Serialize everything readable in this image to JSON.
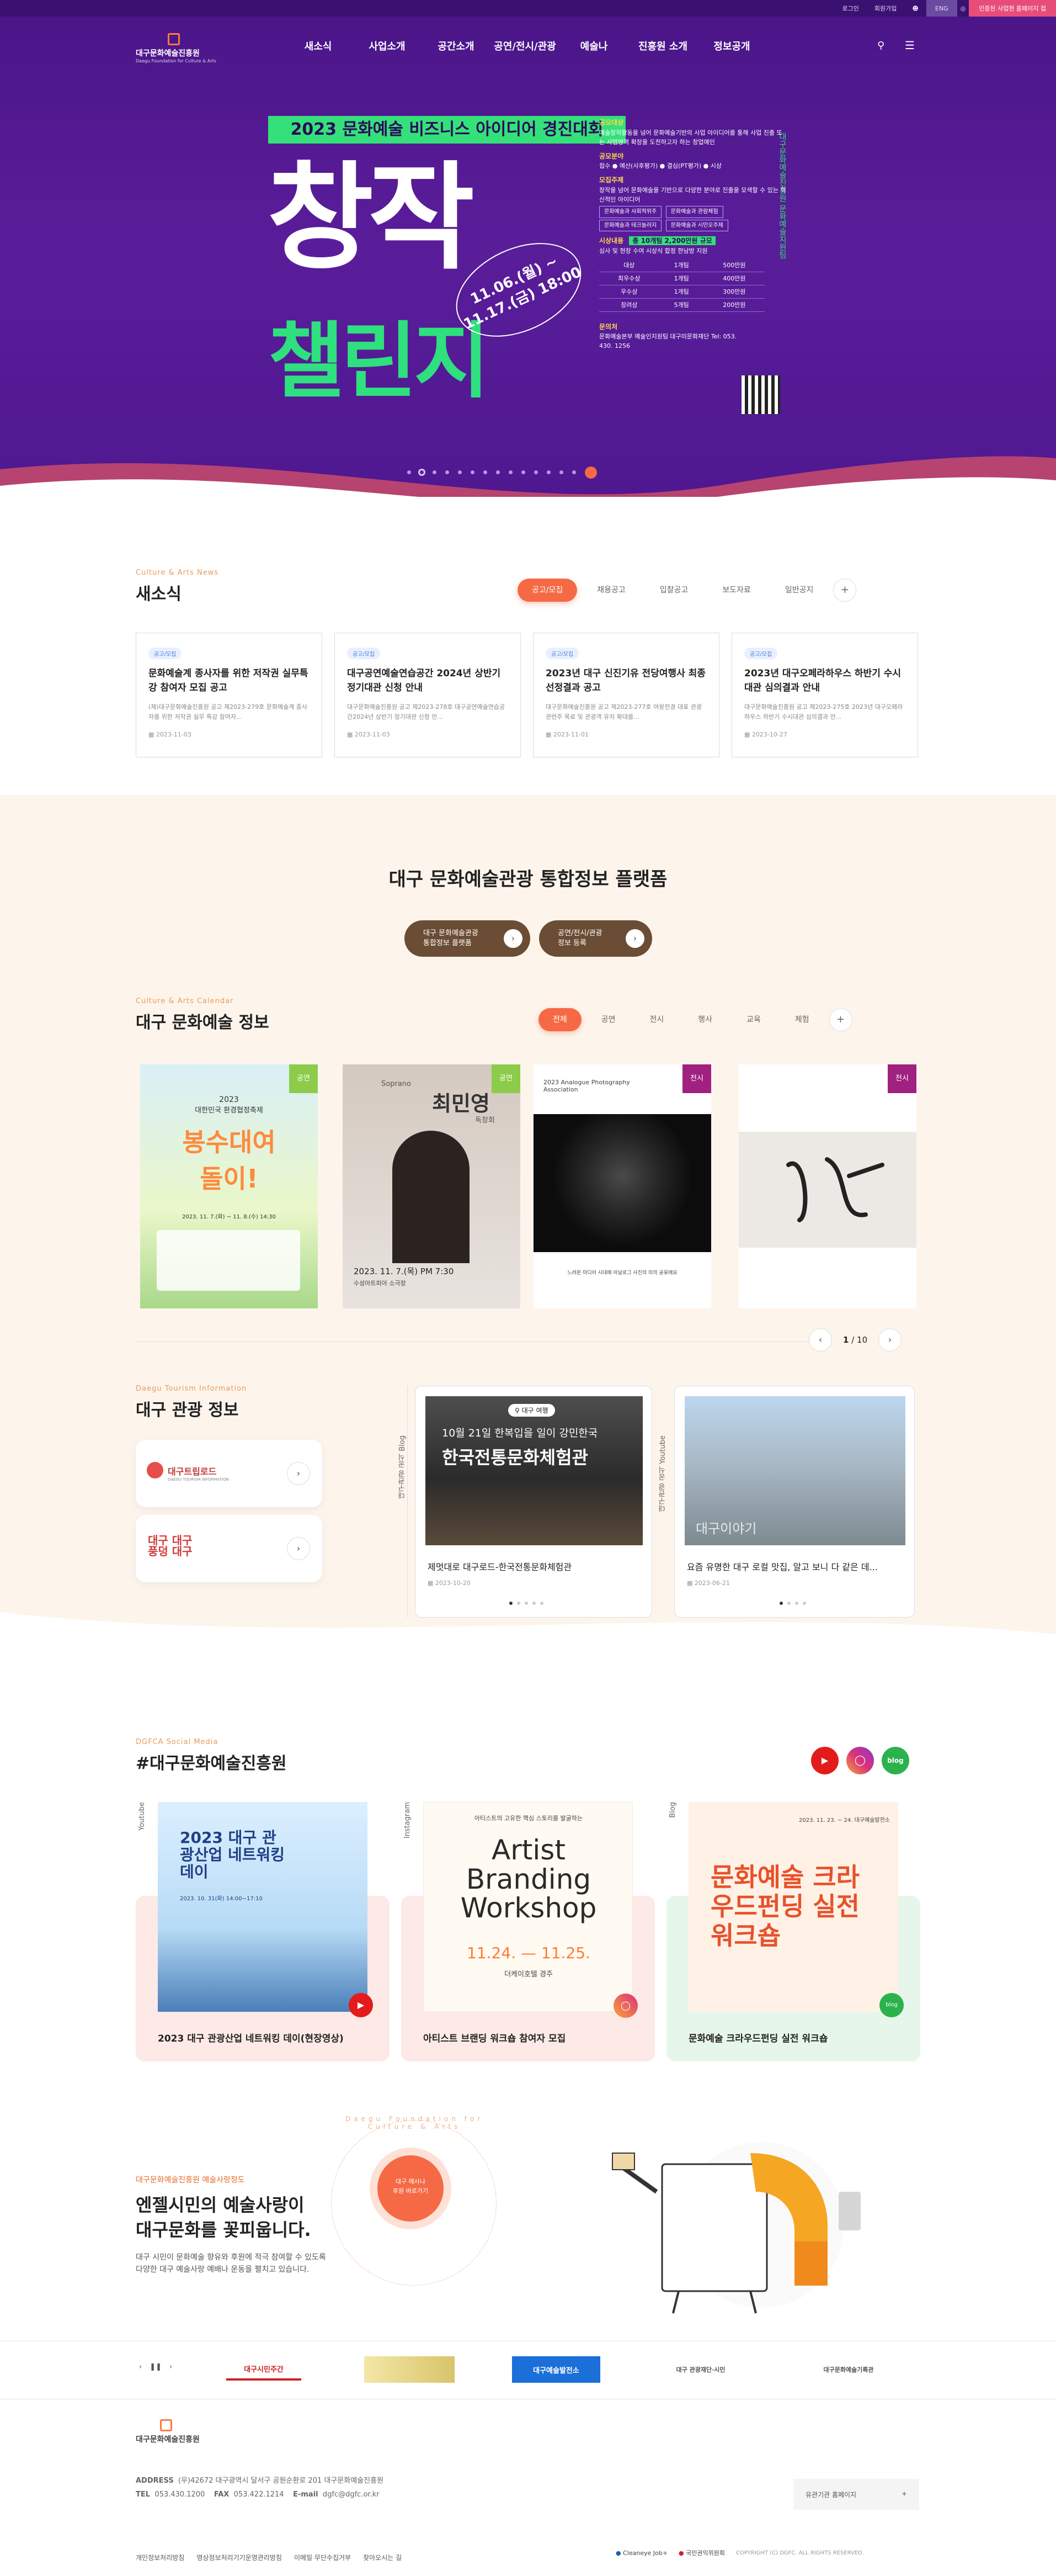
{
  "topbar": {
    "login": "로그인",
    "join": "회원가입",
    "lang": "ENG",
    "ticket": "인증된 사업현 홈페이지 접"
  },
  "header": {
    "logo_name": "대구문화예술진흥원",
    "logo_sub": "Daegu Foundation for Culture & Arts",
    "nav": [
      "새소식",
      "사업소개",
      "공간소개",
      "공연/전시/관광",
      "예술나",
      "진흥원 소개",
      "정보공개"
    ]
  },
  "hero": {
    "contest_title": "2023 문화예술 비즈니스 아이디어 경진대회",
    "big1": "창작",
    "big2": "챌린지",
    "date1": "11.06.(월) ~",
    "date2": "11.17.(금) 18:00",
    "side": "대구문화예술진흥원 문화예술지원팀",
    "info": [
      {
        "h": "공모대상",
        "t": "예술창작활동을 넘어 문화예술기반의 사업 아이디어를 통해 사업 진출 또는 사업영역 확장을 도전하고자 하는 창업예인"
      },
      {
        "h": "공모분야",
        "t": "접수 ● 예산(사후평가) ● 결심(PT평가) ● 시상"
      },
      {
        "h": "모집주제",
        "t": "창작을 넘어 문화예술을 기반으로 다양한 분야로 진출을 모색할 수 있는 혁신적인 아이디어"
      }
    ],
    "chips": [
      "문화예술과 사회적위주",
      "문화예술과 관람체험",
      "문화예술과 테크놀러지",
      "문화예술과 시민오주제"
    ],
    "award_label": "시상내용",
    "award_badge": "총 10개팀 2,200만원 규모",
    "award_note": "심사 및 현장 수여 시상식 합정 한남방 지원",
    "prizes": [
      [
        "대상",
        "1개팀",
        "500만원"
      ],
      [
        "최우수상",
        "1개팀",
        "400만원"
      ],
      [
        "우수상",
        "1개팀",
        "300만원"
      ],
      [
        "장려상",
        "5개팀",
        "200만원"
      ]
    ],
    "inquiry_h": "문의처",
    "inquiry": "문화예술본부 예술인지원팀 대구미문화재단 Tel: 053. 430. 1256"
  },
  "news": {
    "eyebrow": "Culture & Arts News",
    "title": "새소식",
    "tabs": [
      "공고/모집",
      "채용공고",
      "입찰공고",
      "보도자료",
      "일반공지"
    ],
    "plus": "+",
    "items": [
      {
        "badge": "공고/모집",
        "title": "문화예술계 종사자를 위한 저작권 실무특강 참여자 모집 공고",
        "desc": "(재)대구문화예술진흥원 공고 제2023-279호 문화예술계 종사자를 위한 저작권 실무 특강 참여자...",
        "date": "2023-11-03"
      },
      {
        "badge": "공고/모집",
        "title": "대구공연예술연습공간 2024년 상반기 정기대관 신청 안내",
        "desc": "대구문화예술진흥원 공고 제2023-278호 대구공연예술연습공간2024년 상반기 정기대관 신청 안...",
        "date": "2023-11-03"
      },
      {
        "badge": "공고/모집",
        "title": "2023년 대구 신진기유 전당여행사 최종 선정결과 공고",
        "desc": "대구문화예술진흥원 공고 제2023-277호 여왕전경 대표 관광 관련주 목료 및 관광객 유치 확대를...",
        "date": "2023-11-01"
      },
      {
        "badge": "공고/모집",
        "title": "2023년 대구오페라하우스 하반기 수시대관 심의결과 안내",
        "desc": "대구문화예술진흥원 공고 제2023-275호 2023년 대구오페라하우스 하반기 수시대관 심의결과 안...",
        "date": "2023-10-27"
      }
    ]
  },
  "platform": {
    "title": "대구 문화예술관광 통합정보 플랫폼",
    "btn1": [
      "대구 문화예술관광",
      "통합정보 플랫폼"
    ],
    "btn2": [
      "공연/전시/관광",
      "정보 등록"
    ]
  },
  "calendar": {
    "eyebrow": "Culture & Arts Calendar",
    "title": "대구 문화예술 정보",
    "tabs": [
      "전체",
      "공연",
      "전시",
      "행사",
      "교육",
      "체험"
    ],
    "posters": [
      {
        "badge": "공연",
        "year": "2023",
        "line1": "대한민국 환경협정축제",
        "line2": "봉수대여",
        "line3": "돌이!",
        "date": "2023. 11. 7.(화) ~ 11. 8.(수) 14:30",
        "color": "#8ccc4a"
      },
      {
        "badge": "공연",
        "name": "최민영",
        "role": "Soprano",
        "sub": "독창회",
        "date": "2023. 11. 7.(목) PM 7:30",
        "venue": "수성아트피아 소극장",
        "color": "#8ccc4a"
      },
      {
        "badge": "전시",
        "heading": "2023 Analogue Photography Association",
        "caption": "느려운 미디어 시대에 아날로그 사진의 미의 공유에요",
        "color": "#a0217f"
      },
      {
        "badge": "전시",
        "color": "#a0217f"
      }
    ],
    "page_current": "1",
    "page_total": "10"
  },
  "tourism": {
    "eyebrow": "Daegu Tourism Information",
    "title": "대구 관광 정보",
    "card1": "대구트립로드",
    "card1_sub": "DAEGU TOURISM INFORMATION",
    "card2": "대구 대구 풍덩 대구",
    "blog_label": "대구관광 공식 Blog",
    "youtube_label": "대구관광 공식 Youtube",
    "blog": {
      "tag": "대구 여행",
      "head": "10월 21일 한복입을 일이 강민한국",
      "big": "한국전통문화체험관",
      "title": "제멋대로 대구로드-한국전통문화체험관",
      "date": "2023-10-20"
    },
    "youtube": {
      "watermark": "대구이야기",
      "title": "요즘 유명한 대구 로컬 맛집, 알고 보니 다 같은 데...",
      "date": "2023-06-21"
    }
  },
  "social": {
    "eyebrow": "DGFCA Social Media",
    "title": "#대구문화예술진흥원",
    "icons": [
      "Youtube",
      "Instagram",
      "blog"
    ],
    "items": [
      {
        "label": "Youtube",
        "img_title": "2023 대구 관광산업 네트워킹 데이",
        "img_date": "2023. 10. 31(화) 14:00~17:10",
        "caption": "2023 대구 관광산업 네트워킹 데이(현장영상)"
      },
      {
        "label": "Instagram",
        "img_title": "Artist Branding Workshop",
        "img_top": "아티스트의 고유한 핵심 스토리를 발굴하는",
        "img_date": "11.24. — 11.25.",
        "img_venue": "더케이호텔 경주",
        "caption": "아티스트 브랜딩 워크숍 참여자 모집"
      },
      {
        "label": "Blog",
        "img_title": "문화예술 크라우드펀딩 실전 워크숍",
        "img_top": "2023. 11. 23. ~ 24. 대구예술발전소",
        "caption": "문화예술 크라우드펀딩 실전 워크숍"
      }
    ]
  },
  "campaign": {
    "eyebrow": "대구문화예술진흥원 예술사랑정도",
    "title1": "엔젤시민의 예술사랑이",
    "title2": "대구문화를 꽃피웁니다.",
    "desc1": "대구 시민이 문화예술 향유와 후원에 적극 참여할 수 있도록",
    "desc2": "다양한 대구 예술사랑 예배나 운동을 펼치고 있습니다.",
    "badge1": "대구 예사나",
    "badge2": "후원 바로가기",
    "ring": "Daegu Foundation for Culture & Arts"
  },
  "banners": {
    "items": [
      "대구시민주간",
      "",
      "대구예술발전소",
      "대구 관광재단·시민",
      "대구문화예술기록관"
    ]
  },
  "footer": {
    "logo": "대구문화예술진흥원",
    "address_label": "ADDRESS",
    "address": "(우)42672 대구광역시 달서구 공원순환로 201 대구문화예술진흥원",
    "tel_label": "TEL",
    "tel": "053.430.1200",
    "fax_label": "FAX",
    "fax": "053.422.1214",
    "email_label": "E-mail",
    "email": "dgfc@dgfc.or.kr",
    "related": "유관기관 홈페이지",
    "links": [
      "개인정보처리방침",
      "영상정보처리기기운영관리방침",
      "이메일 무단수집거부",
      "찾아오시는 길"
    ],
    "cert1": "Cleaneye Job+",
    "cert2": "국민권익위원회",
    "copy": "COPYRIGHT (C) DGFC. ALL RIGHTS RESERVED."
  },
  "colors": {
    "purple": "#4a1588",
    "green": "#34e07a",
    "orange": "#f56a45",
    "cream": "#fdf5ec",
    "brown": "#6b4d35"
  }
}
